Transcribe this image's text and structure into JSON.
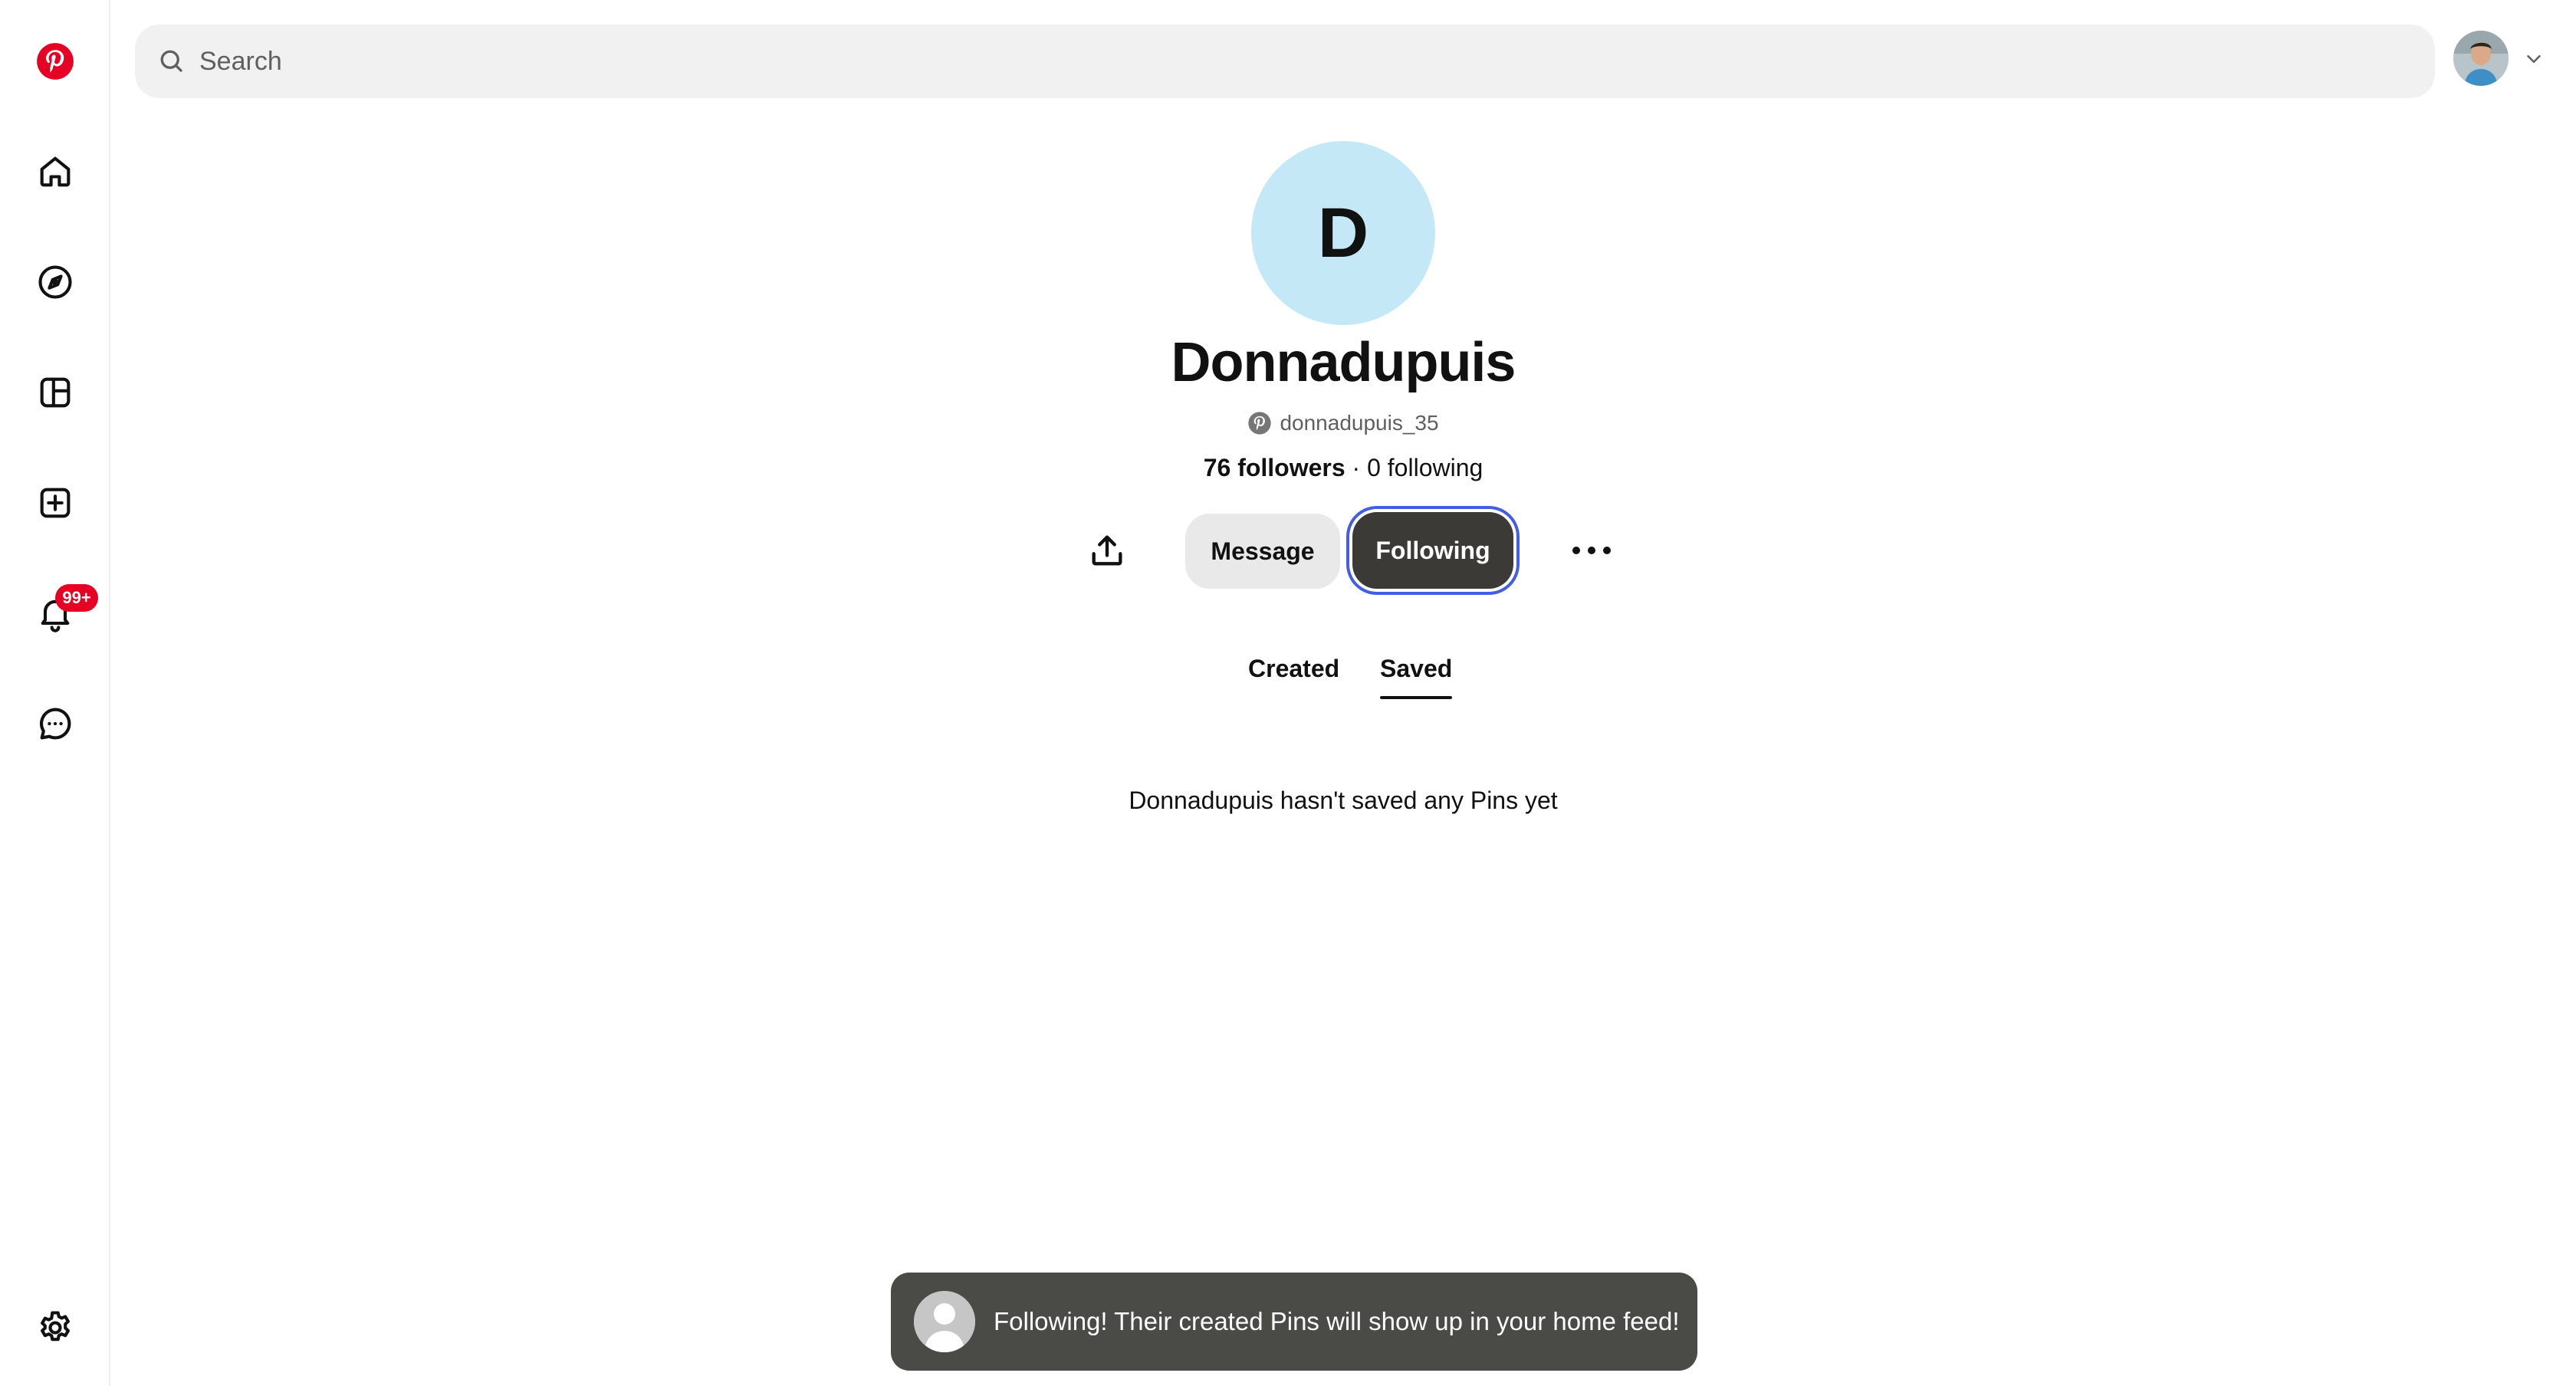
{
  "header": {
    "search_placeholder": "Search"
  },
  "sidebar": {
    "items": [
      {
        "name": "pinterest-logo",
        "icon": "pinterest-logo-icon"
      },
      {
        "name": "home",
        "icon": "home-icon"
      },
      {
        "name": "explore",
        "icon": "compass-icon"
      },
      {
        "name": "boards",
        "icon": "board-icon"
      },
      {
        "name": "create",
        "icon": "plus-square-icon"
      },
      {
        "name": "notifications",
        "icon": "bell-icon"
      },
      {
        "name": "messages",
        "icon": "chat-icon"
      },
      {
        "name": "settings",
        "icon": "gear-icon"
      }
    ],
    "notifications_badge": "99+"
  },
  "profile": {
    "avatar_letter": "D",
    "name": "Donnadupuis",
    "handle": "donnadupuis_35",
    "followers_label": "76 followers",
    "separator": " · ",
    "following_label": "0 following"
  },
  "actions": {
    "message_label": "Message",
    "following_label": "Following"
  },
  "tabs": [
    {
      "label": "Created",
      "active": false
    },
    {
      "label": "Saved",
      "active": true
    }
  ],
  "empty_state": "Donnadupuis hasn't saved any Pins yet",
  "toast": {
    "message": "Following! Their created Pins will show up in your home feed!"
  },
  "colors": {
    "brand": "#e60023",
    "avatar_bg": "#c4e8f6",
    "following_button": "#3b3a36",
    "focus_ring": "#435ee5",
    "toast_bg": "#4a4a46"
  }
}
